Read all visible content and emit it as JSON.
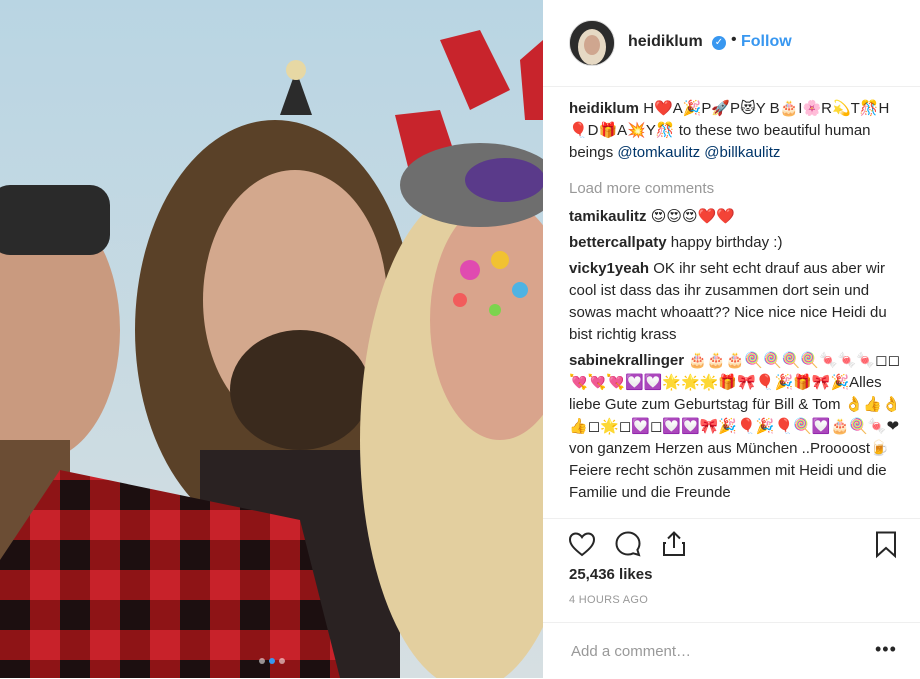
{
  "header": {
    "username": "heidiklum",
    "separator": "•",
    "follow_label": "Follow"
  },
  "caption": {
    "username": "heidiklum",
    "text": "H❤️A🎉P🚀P😻Y B🎂I🌸R💫T🎊H🎈D🎁A💥Y🎊 to these two beautiful human beings ",
    "mention1": "@tomkaulitz",
    "mention2": "@billkaulitz"
  },
  "load_more_label": "Load more comments",
  "comments": [
    {
      "user": "tamikaulitz",
      "text": "😍😍😍❤️❤️"
    },
    {
      "user": "bettercallpaty",
      "text": "happy birthday :)"
    },
    {
      "user": "vicky1yeah",
      "text": "OK ihr seht echt drauf aus aber wir cool ist dass das ihr zusammen dort sein und sowas macht whoaatt?? Nice nice nice Heidi du bist richtig krass"
    },
    {
      "user": "sabinekrallinger",
      "text": "🎂🎂🎂🍭🍭🍭🍭🍬🍬🍬◻◻💘💘💘💟💟🌟🌟🌟🎁🎀🎈🎉🎁🎀🎉Alles liebe Gute zum Geburtstag für Bill & Tom 👌👍👌👍◻🌟◻💟◻💟💟🎀🎉🎈🎉🎈🍭💟🎂🍭🍬❤von ganzem Herzen aus München ..Proooost🍺Feiere recht schön zusammen mit Heidi und die Familie und die Freunde"
    }
  ],
  "likes": "25,436 likes",
  "timestamp": "4 HOURS AGO",
  "add_comment": {
    "placeholder": "Add a comment…"
  },
  "more_label": "•••",
  "carousel": {
    "count": 3,
    "active": 2
  },
  "colors": {
    "link": "#3897f0",
    "mention": "#003569",
    "muted": "#999999"
  },
  "icons": [
    "heart-icon",
    "comment-icon",
    "share-icon",
    "bookmark-icon"
  ]
}
